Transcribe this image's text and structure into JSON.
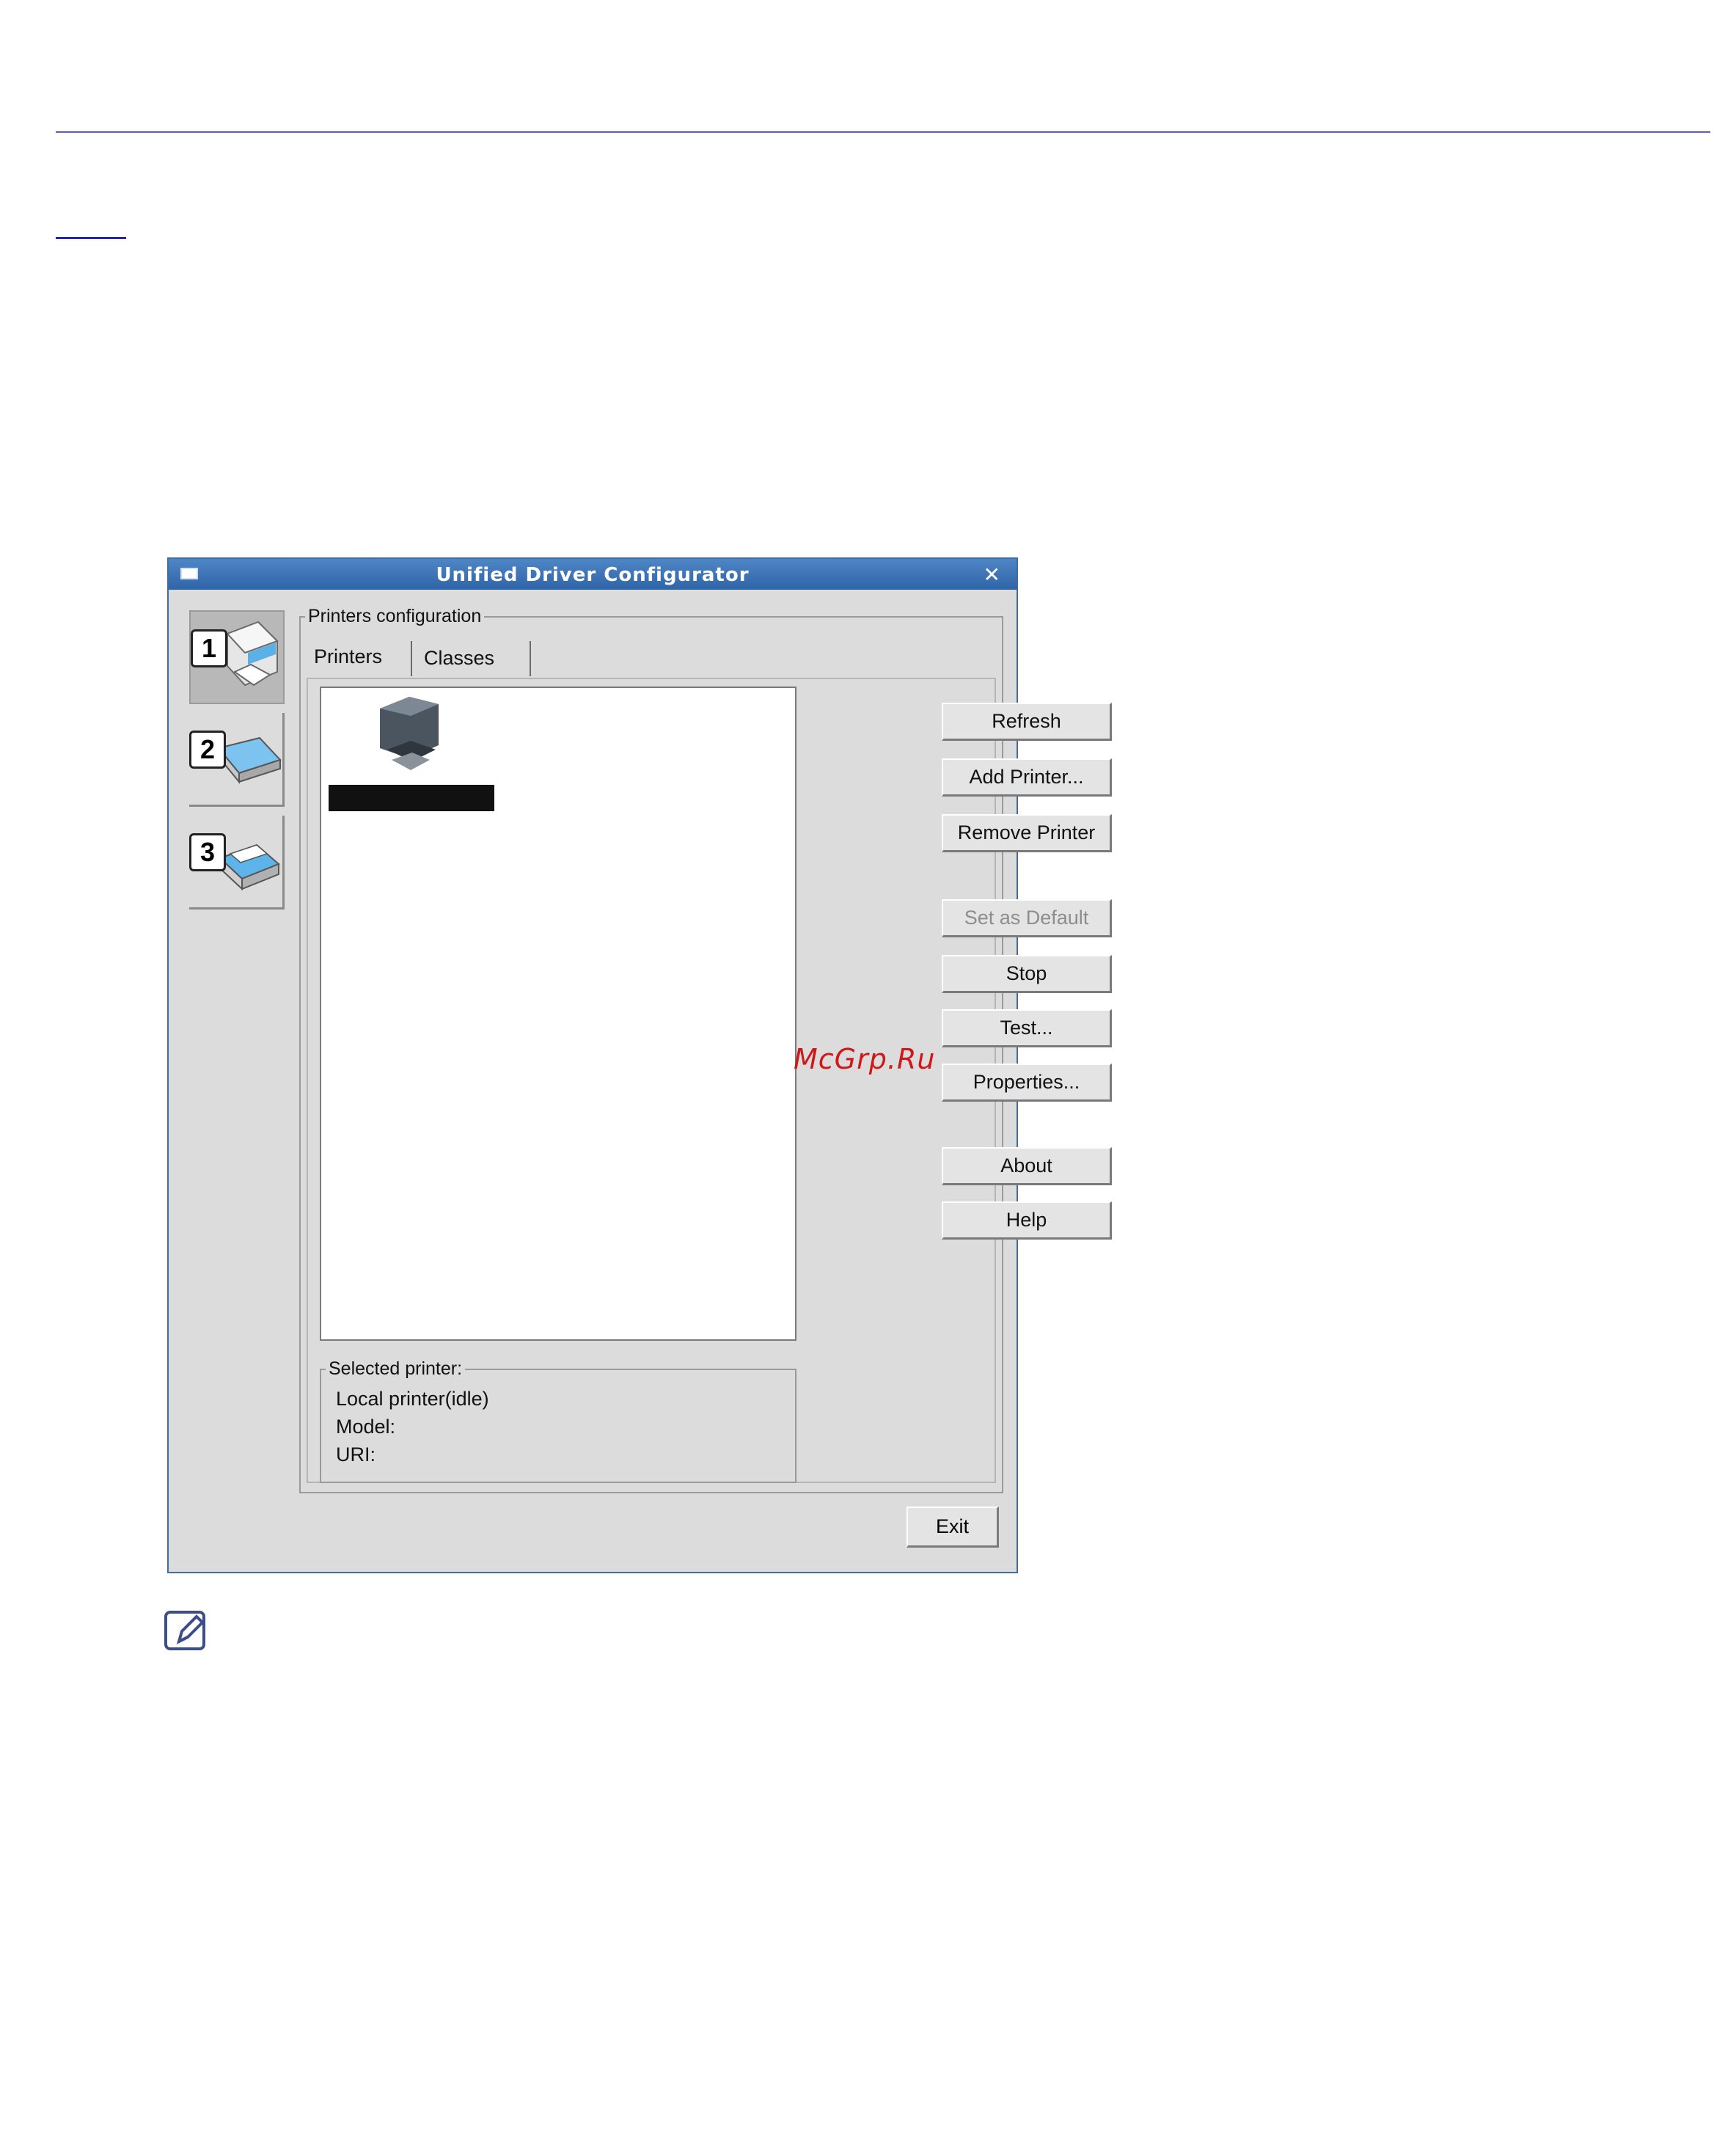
{
  "window": {
    "title": "Unified Driver Configurator"
  },
  "sidebar": {
    "items": [
      {
        "badge": "1",
        "icon": "printer-icon"
      },
      {
        "badge": "2",
        "icon": "scanner-icon"
      },
      {
        "badge": "3",
        "icon": "ports-icon"
      }
    ]
  },
  "printers_config": {
    "group_label": "Printers configuration",
    "tabs": [
      "Printers",
      "Classes"
    ],
    "buttons": {
      "refresh": "Refresh",
      "add_printer": "Add Printer...",
      "remove_printer": "Remove Printer",
      "set_default": "Set as Default",
      "stop": "Stop",
      "test": "Test...",
      "properties": "Properties...",
      "about": "About",
      "help": "Help"
    },
    "selected_printer": {
      "label": "Selected printer:",
      "status": "Local printer(idle)",
      "model": "Model:",
      "uri": "URI:"
    }
  },
  "exit_label": "Exit",
  "watermark": "McGrp.Ru",
  "colors": {
    "title_bar": "#3a72b4",
    "window_bg": "#dcdcdc",
    "rule": "#5a5ac8",
    "watermark": "#d01818"
  }
}
